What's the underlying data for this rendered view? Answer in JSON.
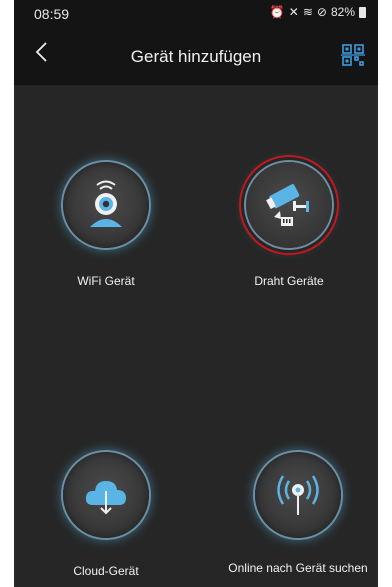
{
  "status": {
    "time": "08:59",
    "battery": "82%"
  },
  "header": {
    "title": "Gerät hinzufügen"
  },
  "options": [
    {
      "label": "WiFi Gerät",
      "icon": "wifi-camera-icon"
    },
    {
      "label": "Draht Geräte",
      "icon": "wired-camera-icon",
      "selected": true
    },
    {
      "label": "Cloud-Gerät",
      "icon": "cloud-download-icon"
    },
    {
      "label": "Online nach Gerät suchen",
      "icon": "radar-search-icon"
    }
  ],
  "colors": {
    "accent": "#5ab4e6",
    "highlight_ring": "#c5161d",
    "background": "#262626"
  }
}
